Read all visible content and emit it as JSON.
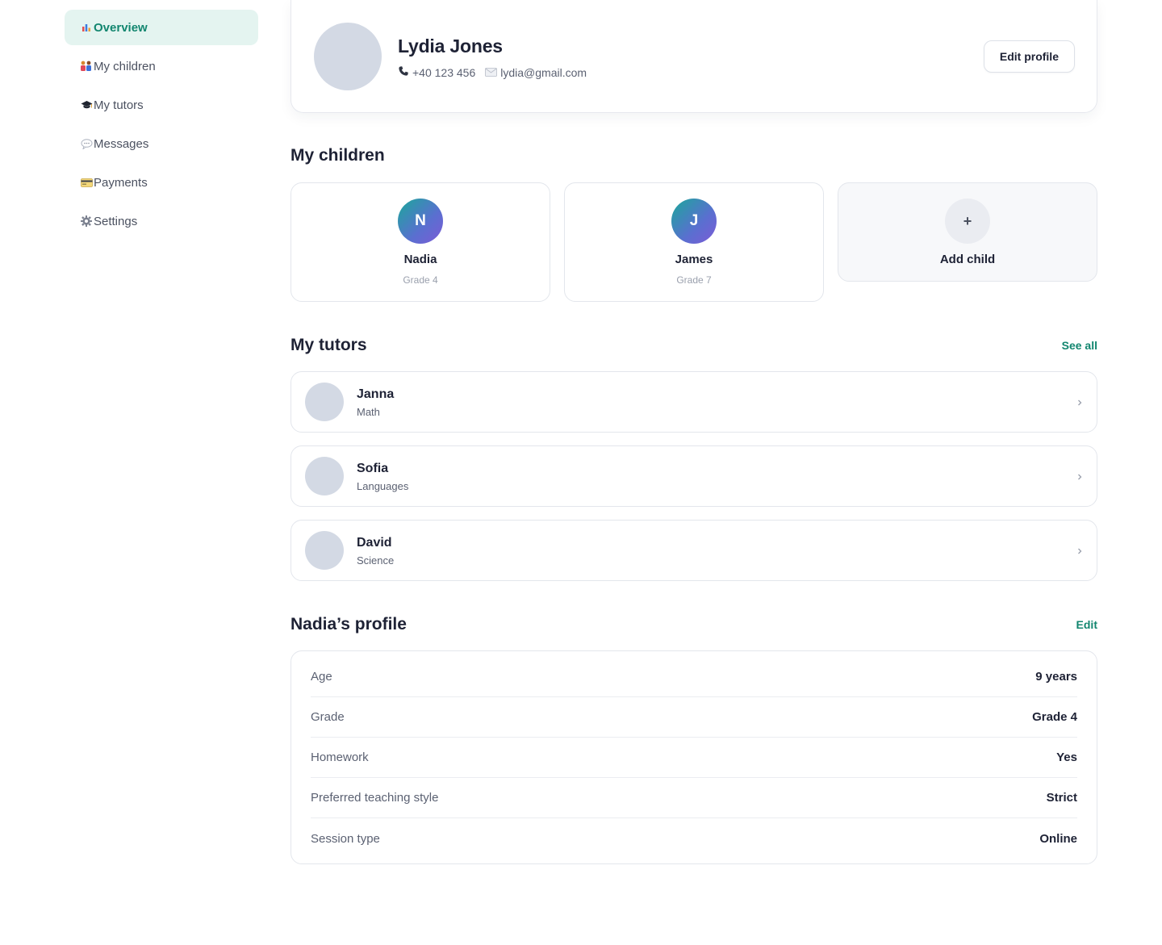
{
  "sidebar": {
    "items": [
      {
        "label": "Overview",
        "icon": "chart-icon",
        "active": true
      },
      {
        "label": "My children",
        "icon": "family-icon",
        "active": false
      },
      {
        "label": "My tutors",
        "icon": "graduation-cap-icon",
        "active": false
      },
      {
        "label": "Messages",
        "icon": "speech-bubble-icon",
        "active": false
      },
      {
        "label": "Payments",
        "icon": "credit-card-icon",
        "active": false
      },
      {
        "label": "Settings",
        "icon": "gear-icon",
        "active": false
      }
    ]
  },
  "profile": {
    "name": "Lydia Jones",
    "phone": "+40 123 456",
    "email": "lydia@gmail.com",
    "edit_label": "Edit profile"
  },
  "children_section": {
    "title": "My children",
    "children": [
      {
        "initial": "N",
        "name": "Nadia",
        "grade": "Grade 4"
      },
      {
        "initial": "J",
        "name": "James",
        "grade": "Grade 7"
      }
    ],
    "add_symbol": "+",
    "add_label": "Add child"
  },
  "tutors_section": {
    "title": "My tutors",
    "link": "See all",
    "tutors": [
      {
        "name": "Janna",
        "subject": "Math"
      },
      {
        "name": "Sofia",
        "subject": "Languages"
      },
      {
        "name": "David",
        "subject": "Science"
      }
    ]
  },
  "child_profile": {
    "title": "Nadia’s profile",
    "link": "Edit",
    "rows": [
      {
        "label": "Age",
        "value": "9 years"
      },
      {
        "label": "Grade",
        "value": "Grade 4"
      },
      {
        "label": "Homework",
        "value": "Yes"
      },
      {
        "label": "Preferred teaching style",
        "value": "Strict"
      },
      {
        "label": "Session type",
        "value": "Online"
      }
    ]
  },
  "colors": {
    "accent": "#12866f",
    "active_bg": "#e4f4f0",
    "avatar_placeholder": "#d3d9e4"
  }
}
